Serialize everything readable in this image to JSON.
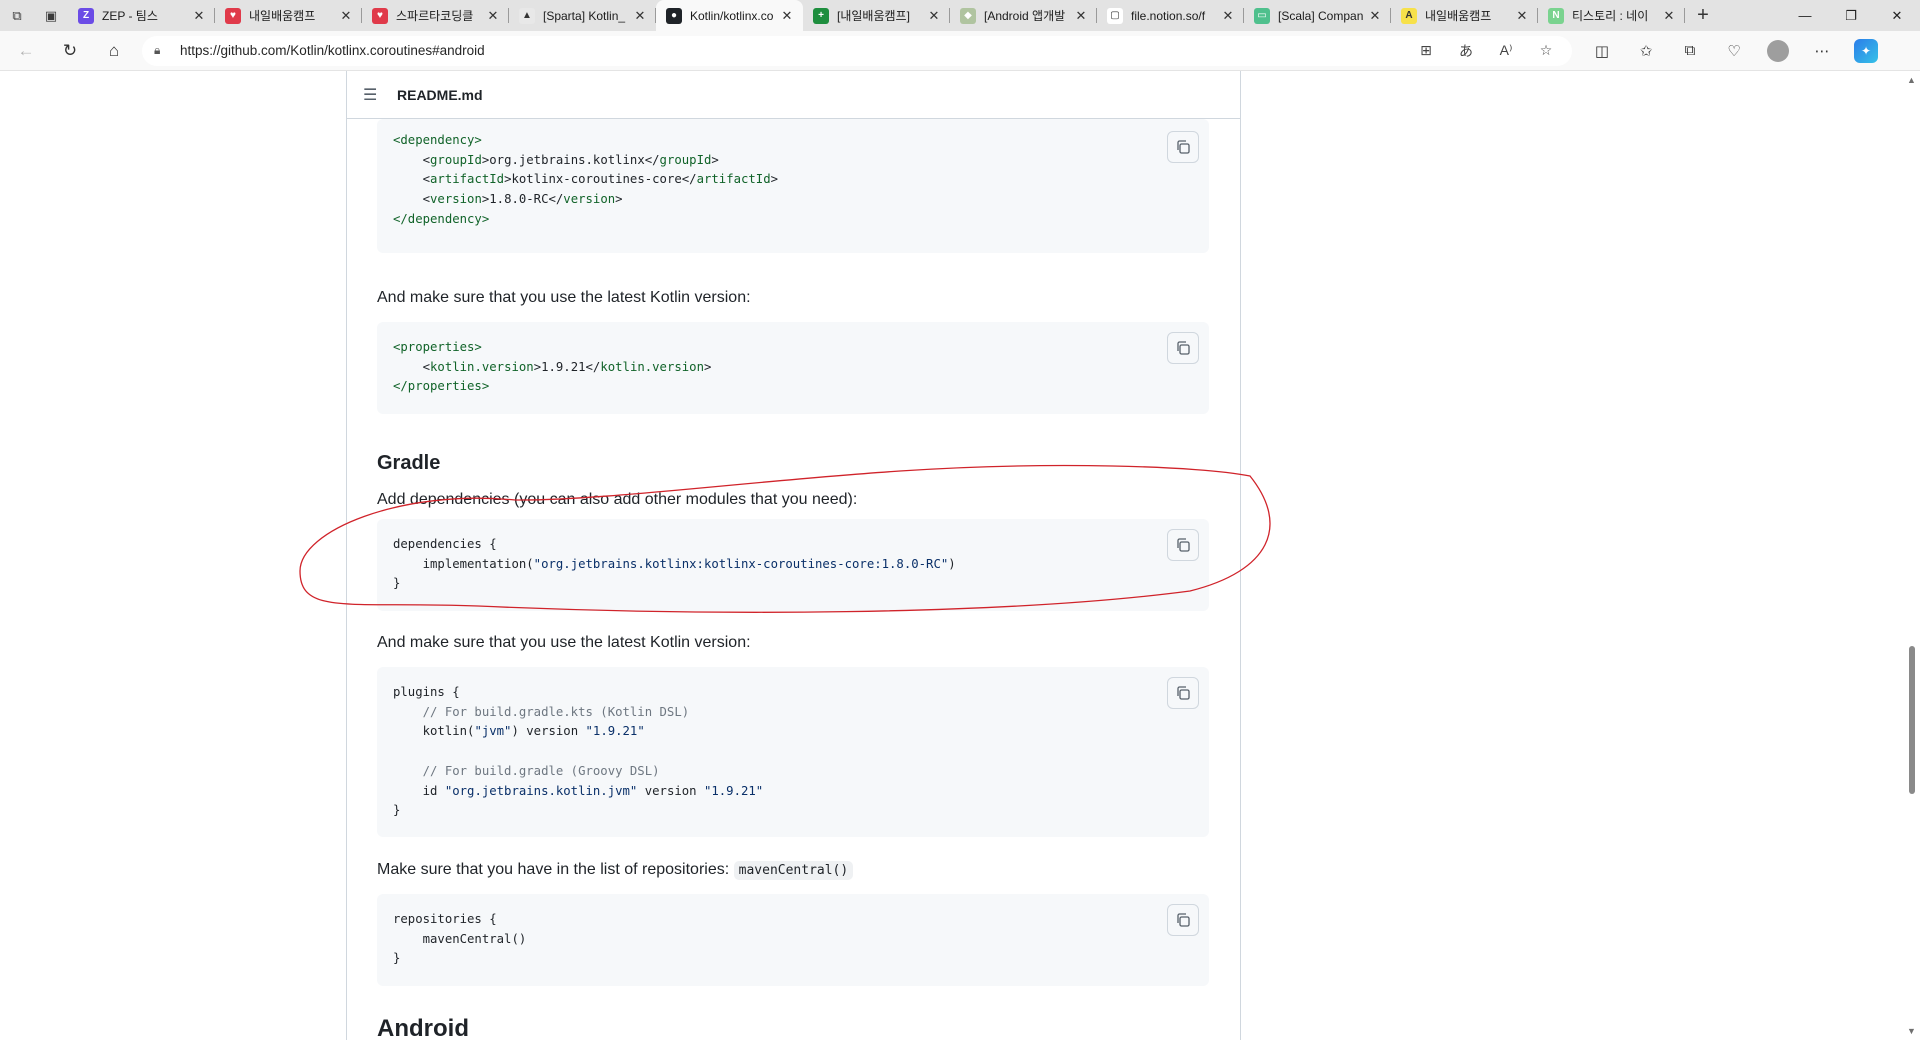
{
  "tabs": [
    {
      "title": "ZEP - 팀스",
      "fav_color": "#6b4ce6",
      "fav_glyph": "Z"
    },
    {
      "title": "내일배움캠프",
      "fav_color": "#e03a4a",
      "fav_glyph": "♥"
    },
    {
      "title": "스파르타코딩클",
      "fav_color": "#e03a4a",
      "fav_glyph": "♥"
    },
    {
      "title": "[Sparta] Kotlin_",
      "fav_color": "#e8e8e8",
      "fav_glyph": "▲"
    },
    {
      "title": "Kotlin/kotlinx.co",
      "fav_color": "#1f2328",
      "fav_glyph": "●"
    },
    {
      "title": "[내일배움캠프]",
      "fav_color": "#1e8e3e",
      "fav_glyph": "+"
    },
    {
      "title": "[Android 앱개발",
      "fav_color": "#b0c4a0",
      "fav_glyph": "◆"
    },
    {
      "title": "file.notion.so/f",
      "fav_color": "#ffffff",
      "fav_glyph": "▢"
    },
    {
      "title": "[Scala] Compan",
      "fav_color": "#4fc08d",
      "fav_glyph": "▭"
    },
    {
      "title": "내일배움캠프",
      "fav_color": "#f7e14a",
      "fav_glyph": "A"
    },
    {
      "title": "티스토리 : 네이",
      "fav_color": "#7ad38f",
      "fav_glyph": "N"
    }
  ],
  "address": {
    "url": "https://github.com/Kotlin/kotlinx.coroutines#android"
  },
  "readme": {
    "filename": "README.md"
  },
  "content": {
    "maven_dependency": {
      "l1": "<dependency>",
      "l2a": "<",
      "l2tag": "groupId",
      "l2b": ">org.jetbrains.kotlinx</",
      "l2tag2": "groupId",
      "l2c": ">",
      "l3a": "<",
      "l3tag": "artifactId",
      "l3b": ">kotlinx-coroutines-core</",
      "l3tag2": "artifactId",
      "l3c": ">",
      "l4a": "<",
      "l4tag": "version",
      "l4b": ">1.8.0-RC</",
      "l4tag2": "version",
      "l4c": ">",
      "l5": "</dependency>"
    },
    "para_latest_1": "And make sure that you use the latest Kotlin version:",
    "maven_properties": {
      "l1": "<properties>",
      "l2a": "<",
      "l2tag": "kotlin.version",
      "l2b": ">1.9.21</",
      "l2tag2": "kotlin.version",
      "l2c": ">",
      "l3": "</properties>"
    },
    "heading_gradle": "Gradle",
    "para_add_deps": "Add dependencies (you can also add other modules that you need):",
    "gradle_deps": {
      "l1": "dependencies {",
      "l2a": "    implementation(",
      "l2str": "\"org.jetbrains.kotlinx:kotlinx-coroutines-core:1.8.0-RC\"",
      "l2b": ")",
      "l3": "}"
    },
    "para_latest_2": "And make sure that you use the latest Kotlin version:",
    "gradle_plugins": {
      "l1": "plugins {",
      "l2": "    // For build.gradle.kts (Kotlin DSL)",
      "l3a": "    kotlin(",
      "l3str": "\"jvm\"",
      "l3b": ") version ",
      "l3str2": "\"1.9.21\"",
      "l5": "    // For build.gradle (Groovy DSL)",
      "l6a": "    id ",
      "l6str": "\"org.jetbrains.kotlin.jvm\"",
      "l6b": " version ",
      "l6str2": "\"1.9.21\"",
      "l7": "}"
    },
    "para_repos": "Make sure that you have in the list of repositories:",
    "inline_mavencentral": "mavenCentral()",
    "gradle_repos": {
      "l1": "repositories {",
      "l2": "    mavenCentral()",
      "l3": "}"
    },
    "heading_android": "Android"
  },
  "colors": {
    "annotation_stroke": "#d0232a",
    "code_bg": "#f6f8fa",
    "border": "#d0d7de"
  }
}
